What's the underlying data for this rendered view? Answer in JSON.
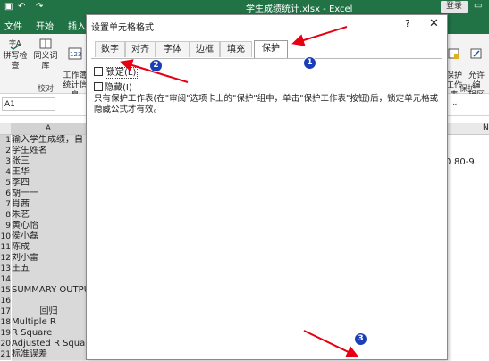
{
  "excel": {
    "window_title": "学生成绩统计.xlsx - Excel",
    "login_label": "登录",
    "ribbon_tabs": [
      "文件",
      "开始",
      "插入"
    ],
    "ribbon": {
      "spell_check": "拼写检查",
      "thesaurus": "同义词库",
      "workbook_stats": "工作簿\n统计信息",
      "proofing_group": "校对",
      "protect_right": "保护\n工作表",
      "allow_edit": "允许编\n辑区域",
      "protect_group": "保护"
    },
    "name_box": "A1",
    "column_headers": {
      "a": "A",
      "n": "N"
    },
    "right_cells": [
      "0",
      "80-9"
    ],
    "rows": [
      {
        "n": "1",
        "text": "输入学生成绩，自"
      },
      {
        "n": "2",
        "text": "学生姓名"
      },
      {
        "n": "3",
        "text": "张三"
      },
      {
        "n": "4",
        "text": "王华"
      },
      {
        "n": "5",
        "text": "李四"
      },
      {
        "n": "6",
        "text": "胡一一"
      },
      {
        "n": "7",
        "text": "肖茜"
      },
      {
        "n": "8",
        "text": "朱艺"
      },
      {
        "n": "9",
        "text": "黄心怡"
      },
      {
        "n": "10",
        "text": "侯小磊"
      },
      {
        "n": "11",
        "text": "陈成"
      },
      {
        "n": "12",
        "text": "刘小雷"
      },
      {
        "n": "13",
        "text": "王五"
      },
      {
        "n": "14",
        "text": ""
      },
      {
        "n": "15",
        "text": "SUMMARY OUTPU"
      },
      {
        "n": "16",
        "text": ""
      },
      {
        "n": "17",
        "text": "回归"
      },
      {
        "n": "18",
        "text": "Multiple R"
      },
      {
        "n": "19",
        "text": "R Square"
      },
      {
        "n": "20",
        "text": "Adjusted R Square"
      },
      {
        "n": "21",
        "text": "标准误差"
      }
    ]
  },
  "dialog": {
    "title": "设置单元格格式",
    "help": "?",
    "close": "✕",
    "tabs": [
      "数字",
      "对齐",
      "字体",
      "边框",
      "填充",
      "保护"
    ],
    "active_tab": "保护",
    "locked_label": "锁定(L)",
    "hidden_label": "隐藏(I)",
    "locked_checked": false,
    "hidden_checked": false,
    "description": "只有保护工作表(在\"审阅\"选项卡上的\"保护\"组中，单击\"保护工作表\"按钮)后，锁定单元格或隐藏公式才有效。"
  },
  "annotations": {
    "badges": [
      "1",
      "2",
      "3"
    ],
    "arrow_color": "#e60012",
    "badge_color": "#1a3db8"
  }
}
